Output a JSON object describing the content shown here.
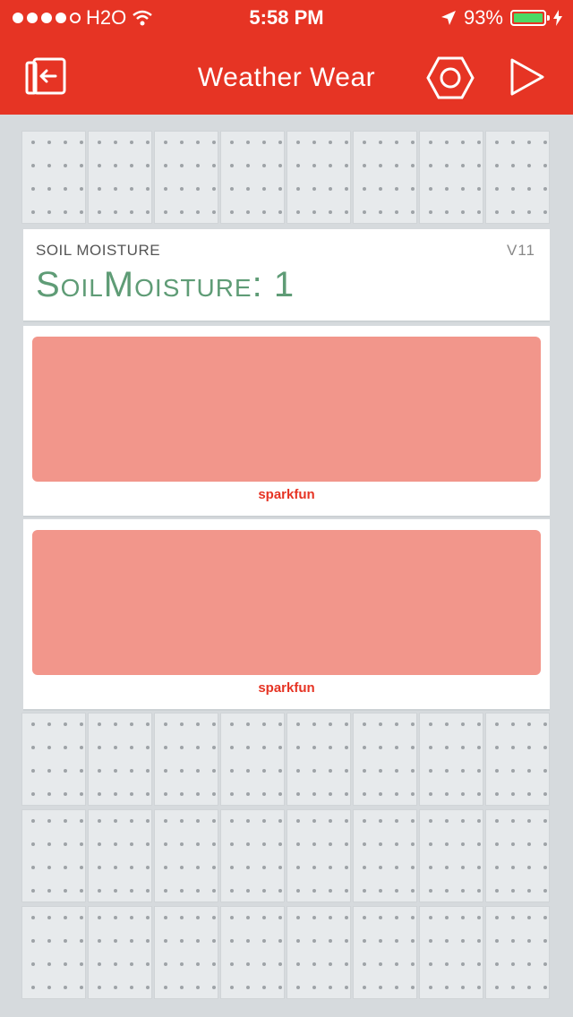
{
  "status": {
    "carrier": "H2O",
    "time": "5:58 PM",
    "battery": "93%",
    "battery_level": 0.93
  },
  "nav": {
    "title": "Weather Wear",
    "back_icon": "exit-icon",
    "settings_icon": "hexagon-settings-icon",
    "play_icon": "play-icon"
  },
  "widgets": {
    "label": {
      "title": "SOIL MOISTURE",
      "pin": "V11",
      "value": "SoilMoisture: 1"
    },
    "button1": {
      "brand": "sparkfun"
    },
    "button2": {
      "brand": "sparkfun"
    }
  },
  "colors": {
    "header": "#e63424",
    "value_text": "#5f9c76",
    "button_face": "#f2968b",
    "background": "#d6dadd"
  }
}
